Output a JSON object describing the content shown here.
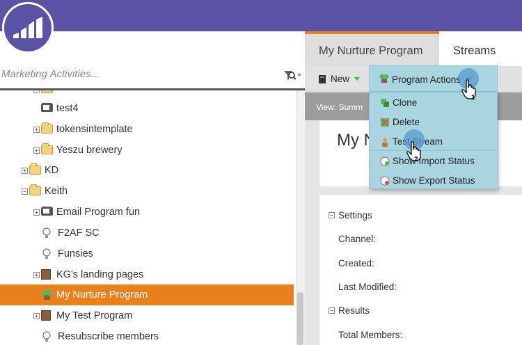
{
  "colors": {
    "brand": "#5a53a5",
    "selected": "#e9801b",
    "menu": "#a9d5e0"
  },
  "search": {
    "placeholder": "Marketing Activities..."
  },
  "tree": [
    {
      "label": "",
      "icon": "folder-icon",
      "expandable": true
    },
    {
      "label": "test4",
      "icon": "email-icon",
      "expandable": false
    },
    {
      "label": "tokensintemplate",
      "icon": "folder-icon",
      "expandable": true
    },
    {
      "label": "Yeszu brewery",
      "icon": "folder-icon",
      "expandable": true
    },
    {
      "label": "KD",
      "icon": "folder-icon",
      "expandable": true
    },
    {
      "label": "Keith",
      "icon": "folder-icon",
      "expandable": true,
      "expanded": true
    },
    {
      "label": "Email Program fun",
      "icon": "email-program-icon",
      "expandable": true
    },
    {
      "label": "F2AF SC",
      "icon": "lightbulb-icon",
      "expandable": false
    },
    {
      "label": "Funsies",
      "icon": "lightbulb-icon",
      "expandable": false
    },
    {
      "label": "KG's landing pages",
      "icon": "program-book-icon",
      "expandable": true
    },
    {
      "label": "My Nurture Program",
      "icon": "nurture-program-icon",
      "expandable": false,
      "selected": true
    },
    {
      "label": "My Test Program",
      "icon": "program-book-icon",
      "expandable": true
    },
    {
      "label": "Resubscribe members",
      "icon": "lightbulb-icon",
      "expandable": false
    }
  ],
  "tabs": [
    {
      "label": "My Nurture Program"
    },
    {
      "label": "Streams"
    }
  ],
  "toolbar": {
    "new_label": "New"
  },
  "view": {
    "label": "View: Summ"
  },
  "card": {
    "title": "My N"
  },
  "details": {
    "settings_label": "Settings",
    "channel_label": "Channel:",
    "created_label": "Created:",
    "modified_label": "Last Modified:",
    "results_label": "Results",
    "members_label": "Total Members:"
  },
  "menu": {
    "title": "Program Actions",
    "items": [
      {
        "label": "Clone",
        "icon": "clone-icon"
      },
      {
        "label": "Delete",
        "icon": "delete-icon"
      },
      {
        "label": "Test Stream",
        "icon": "test-stream-icon"
      },
      {
        "label": "Show Import Status",
        "icon": "import-status-icon"
      },
      {
        "label": "Show Export Status",
        "icon": "export-status-icon"
      }
    ]
  },
  "annotations": {
    "step1": "1",
    "step2": "2"
  }
}
